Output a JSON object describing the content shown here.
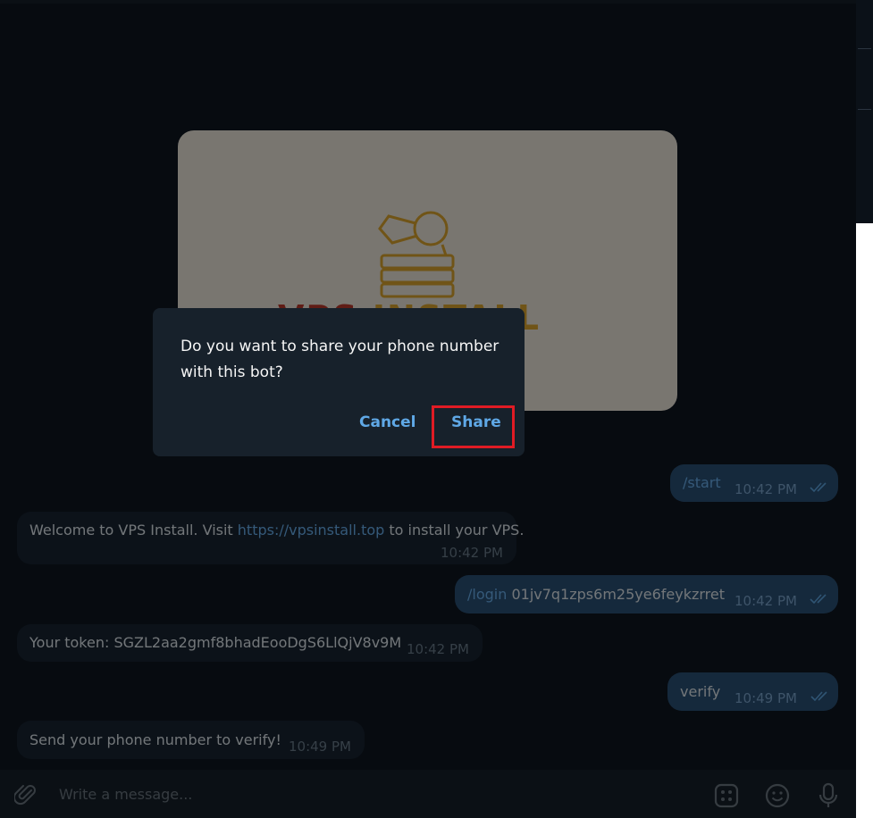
{
  "dialog": {
    "message": "Do you want to share your phone number with this bot?",
    "cancel_label": "Cancel",
    "share_label": "Share"
  },
  "photo": {
    "brand_left": "VPS ",
    "brand_right": "INSTALL"
  },
  "messages": [
    {
      "side": "out",
      "text": "/start",
      "time": "10:42 PM"
    },
    {
      "side": "in",
      "text_before": "Welcome to VPS Install. Visit ",
      "link": "https://vpsinstall.top",
      "text_after": " to install your VPS.",
      "time": "10:42 PM"
    },
    {
      "side": "out",
      "command": "/login",
      "text": " 01jv7q1zps6m25ye6feykzrret",
      "time": "10:42 PM"
    },
    {
      "side": "in",
      "text": "Your token: SGZL2aa2gmf8bhadEooDgS6LlQjV8v9M",
      "time": "10:42 PM"
    },
    {
      "side": "out",
      "text": "verify",
      "time": "10:49 PM"
    },
    {
      "side": "in",
      "text": "Send your phone number to verify!",
      "time": "10:49 PM"
    }
  ],
  "composer": {
    "placeholder": "Write a message...",
    "icons": [
      "paperclip-icon",
      "bot-commands-icon",
      "emoji-icon",
      "microphone-icon"
    ]
  },
  "colors": {
    "accent": "#5fa8e6",
    "highlight": "#e01b24",
    "background": "#0e1621"
  }
}
